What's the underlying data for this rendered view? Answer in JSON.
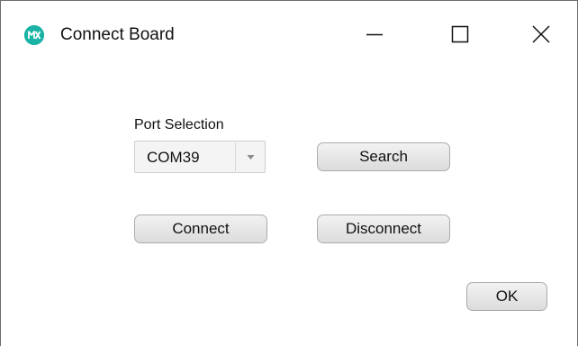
{
  "window": {
    "title": "Connect Board",
    "app_icon": "maxim-logo-icon",
    "controls": {
      "minimize": "minimize-icon",
      "maximize": "maximize-icon",
      "close": "close-icon"
    }
  },
  "port_selection": {
    "label": "Port Selection",
    "selected": "COM39"
  },
  "buttons": {
    "search": "Search",
    "connect": "Connect",
    "disconnect": "Disconnect",
    "ok": "OK"
  },
  "colors": {
    "app_icon": "#1ab3a6",
    "button_border": "#acacac"
  }
}
